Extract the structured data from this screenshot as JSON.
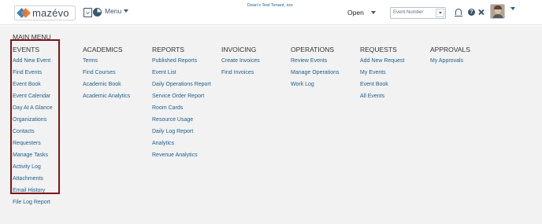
{
  "header": {
    "logo_text": "mazévo",
    "menu_label": "Menu",
    "tenant": "Dean's Test Tenant, xxx",
    "status_select": "Open",
    "search_select": "Event Number",
    "icons": [
      "calendar-check-icon",
      "pie-chart-icon",
      "bell-icon",
      "help-icon",
      "tools-icon",
      "avatar"
    ]
  },
  "menu": {
    "title": "MAIN MENU",
    "columns": [
      {
        "title": "EVENTS",
        "items": [
          "Add New Event",
          "Find Events",
          "Event Book",
          "Event Calendar",
          "Day At A Glance",
          "Organizations",
          "Contacts",
          "Requesters",
          "Manage Tasks",
          "Activity Log",
          "Attachments",
          "Email History",
          "File Log Report"
        ]
      },
      {
        "title": "ACADEMICS",
        "items": [
          "Terms",
          "Find Courses",
          "Academic Book",
          "Academic Analytics"
        ]
      },
      {
        "title": "REPORTS",
        "items": [
          "Published Reports",
          "Event List",
          "Daily Operations Report",
          "Service Order Report",
          "Room Cards",
          "Resource Usage",
          "Daily Log Report",
          "Analytics",
          "Revenue Analytics"
        ]
      },
      {
        "title": "INVOICING",
        "items": [
          "Create Invoices",
          "Find Invoices"
        ]
      },
      {
        "title": "OPERATIONS",
        "items": [
          "Review Events",
          "Manage Operations",
          "Work Log"
        ]
      },
      {
        "title": "REQUESTS",
        "items": [
          "Add New Request",
          "My Events",
          "Event Book",
          "All Events"
        ]
      },
      {
        "title": "APPROVALS",
        "items": [
          "My Approvals"
        ]
      }
    ]
  },
  "colors": {
    "link": "#1d5f88",
    "highlight": "#7b1619",
    "background": "#f2f2f2"
  }
}
